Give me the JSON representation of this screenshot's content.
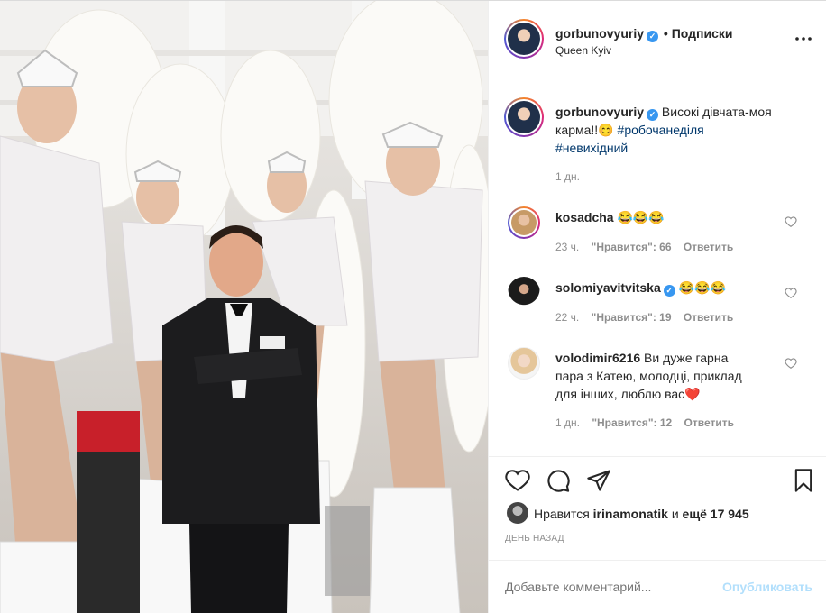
{
  "header": {
    "username": "gorbunovyuriy",
    "follow_label": "Подписки",
    "separator": "•",
    "location": "Queen Kyiv",
    "more_icon": "more-horizontal-icon"
  },
  "caption": {
    "username": "gorbunovyuriy",
    "text_line1": "Високі дівчата-моя",
    "text_line2_prefix": "карма!!",
    "emoji": "😊",
    "hashtag1": "#робочанеділя",
    "hashtag2": "#невихідний",
    "time": "1 дн."
  },
  "comments": [
    {
      "username": "kosadcha",
      "text": "😂😂😂",
      "time": "23 ч.",
      "likes": "\"Нравится\": 66",
      "reply": "Ответить",
      "verified": false
    },
    {
      "username": "solomiyavitvitska",
      "text": "😂😂😂",
      "time": "22 ч.",
      "likes": "\"Нравится\": 19",
      "reply": "Ответить",
      "verified": true
    },
    {
      "username": "volodimir6216",
      "text_line1": "Ви дуже гарна",
      "text_line2": "пара з Катею, молодці, приклад",
      "text_line3": "для інших, люблю вас",
      "emoji": "❤️",
      "time": "1 дн.",
      "likes": "\"Нравится\": 12",
      "reply": "Ответить",
      "verified": false
    }
  ],
  "likes": {
    "prefix": "Нравится",
    "user": "irinamonatik",
    "middle": "и",
    "count": "ещё 17 945",
    "date": "ДЕНЬ НАЗАД"
  },
  "add_comment": {
    "placeholder": "Добавьте комментарий...",
    "publish": "Опубликовать"
  },
  "colors": {
    "verified": "#3897f0",
    "publish": "#b2dffc",
    "hashtag": "#00376b"
  }
}
